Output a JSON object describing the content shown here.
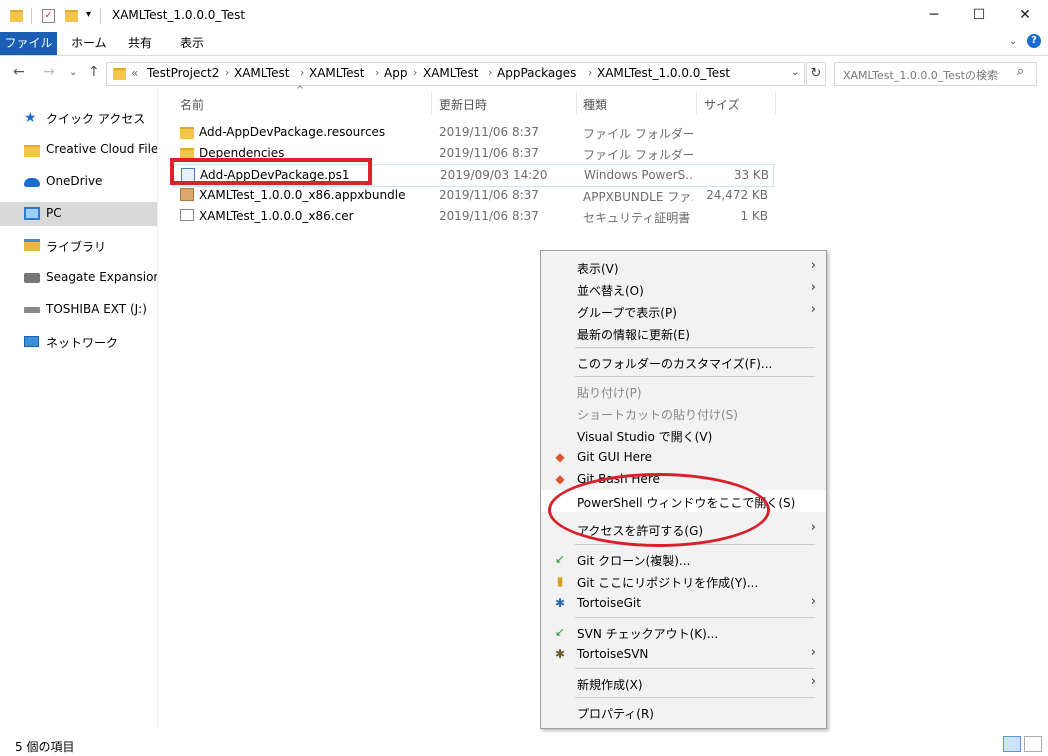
{
  "window": {
    "title": "XAMLTest_1.0.0.0_Test",
    "minimize": "─",
    "maximize": "☐",
    "close": "✕"
  },
  "ribbon": {
    "file": "ファイル",
    "tabs": [
      "ホーム",
      "共有",
      "表示"
    ]
  },
  "address": {
    "prefix": "«",
    "crumbs": [
      "TestProject2",
      "XAMLTest",
      "XAMLTest",
      "App",
      "XAMLTest",
      "AppPackages",
      "XAMLTest_1.0.0.0_Test"
    ],
    "search_placeholder": "XAMLTest_1.0.0.0_Testの検索"
  },
  "nav": {
    "items": [
      "クイック アクセス",
      "Creative Cloud Files",
      "OneDrive",
      "PC",
      "ライブラリ",
      "Seagate Expansion Drive",
      "TOSHIBA EXT (J:)",
      "ネットワーク"
    ]
  },
  "columns": {
    "name": "名前",
    "date": "更新日時",
    "type": "種類",
    "size": "サイズ"
  },
  "files": [
    {
      "name": "Add-AppDevPackage.resources",
      "date": "2019/11/06 8:37",
      "type": "ファイル フォルダー",
      "size": ""
    },
    {
      "name": "Dependencies",
      "date": "2019/11/06 8:37",
      "type": "ファイル フォルダー",
      "size": ""
    },
    {
      "name": "Add-AppDevPackage.ps1",
      "date": "2019/09/03 14:20",
      "type": "Windows PowerS...",
      "size": "33 KB"
    },
    {
      "name": "XAMLTest_1.0.0.0_x86.appxbundle",
      "date": "2019/11/06 8:37",
      "type": "APPXBUNDLE ファ...",
      "size": "24,472 KB"
    },
    {
      "name": "XAMLTest_1.0.0.0_x86.cer",
      "date": "2019/11/06 8:37",
      "type": "セキュリティ証明書",
      "size": "1 KB"
    }
  ],
  "menu": {
    "view": "表示(V)",
    "sort": "並べ替え(O)",
    "group": "グループで表示(P)",
    "refresh": "最新の情報に更新(E)",
    "customize": "このフォルダーのカスタマイズ(F)...",
    "paste": "貼り付け(P)",
    "paste_shortcut": "ショートカットの貼り付け(S)",
    "vs_open": "Visual Studio で開く(V)",
    "git_gui": "Git GUI Here",
    "git_bash": "Git Bash Here",
    "powershell": "PowerShell ウィンドウをここで開く(S)",
    "access": "アクセスを許可する(G)",
    "git_clone": "Git クローン(複製)...",
    "git_create": "Git ここにリポジトリを作成(Y)...",
    "tortoisegit": "TortoiseGit",
    "svn_checkout": "SVN チェックアウト(K)...",
    "tortoisesvn": "TortoiseSVN",
    "new": "新規作成(X)",
    "properties": "プロパティ(R)"
  },
  "status": {
    "count": "5 個の項目"
  }
}
